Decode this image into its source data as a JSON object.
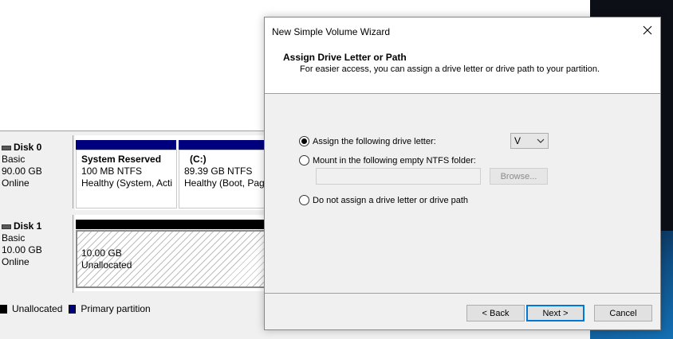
{
  "disk_management": {
    "disks": [
      {
        "name": "Disk 0",
        "type": "Basic",
        "size": "90.00 GB",
        "status": "Online",
        "partitions": [
          {
            "name": "System Reserved",
            "detail": "100 MB NTFS",
            "health": "Healthy (System, Acti"
          },
          {
            "name": "(C:)",
            "detail": "89.39 GB NTFS",
            "health": "Healthy (Boot, Pag"
          }
        ]
      },
      {
        "name": "Disk 1",
        "type": "Basic",
        "size": "10.00 GB",
        "status": "Online",
        "partitions": [
          {
            "size": "10.00 GB",
            "status": "Unallocated"
          }
        ]
      }
    ],
    "legend": [
      {
        "label": "Unallocated",
        "color": "#000000"
      },
      {
        "label": "Primary partition",
        "color": "#00007f"
      }
    ]
  },
  "wizard": {
    "title": "New Simple Volume Wizard",
    "close_icon": "close-icon",
    "header_title": "Assign Drive Letter or Path",
    "header_subtitle": "For easier access, you can assign a drive letter or drive path to your partition.",
    "options": {
      "assign_letter": {
        "label": "Assign the following drive letter:",
        "selected": true
      },
      "mount_folder": {
        "label": "Mount in the following empty NTFS folder:",
        "selected": false
      },
      "no_assign": {
        "label": "Do not assign a drive letter or drive path",
        "selected": false
      }
    },
    "drive_letter": "V",
    "folder_path": "",
    "browse_label": "Browse...",
    "buttons": {
      "back": "< Back",
      "next": "Next >",
      "cancel": "Cancel"
    },
    "accent_color": "#0078d7"
  }
}
